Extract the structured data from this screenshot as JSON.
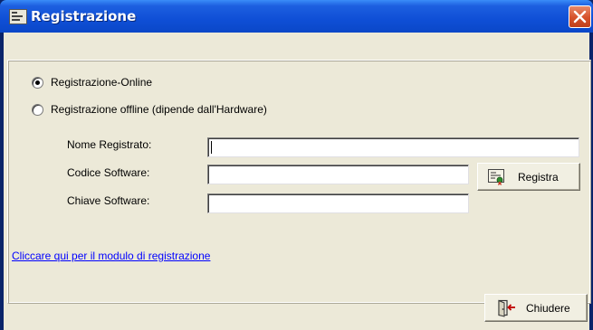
{
  "window": {
    "title": "Registrazione"
  },
  "options": {
    "online": {
      "label": "Registrazione-Online",
      "checked": true
    },
    "offline": {
      "label": "Registrazione offline (dipende dall'Hardware)",
      "checked": false
    }
  },
  "form": {
    "nome_label": "Nome Registrato:",
    "nome_value": "",
    "codice_label": "Codice Software:",
    "codice_value": "",
    "chiave_label": "Chiave Software:",
    "chiave_value": ""
  },
  "buttons": {
    "registra": "Registra",
    "chiudere": "Chiudere"
  },
  "link": {
    "text": "Cliccare qui per il modulo di registrazione"
  },
  "icons": {
    "title": "app-window-icon",
    "registra": "certificate-icon",
    "chiudere": "exit-door-icon",
    "close": "close-x-icon"
  },
  "colors": {
    "titlebar": "#0F4FD6",
    "client_bg": "#ECE9D8",
    "link": "#0000FF",
    "close_button": "#D6512A"
  }
}
